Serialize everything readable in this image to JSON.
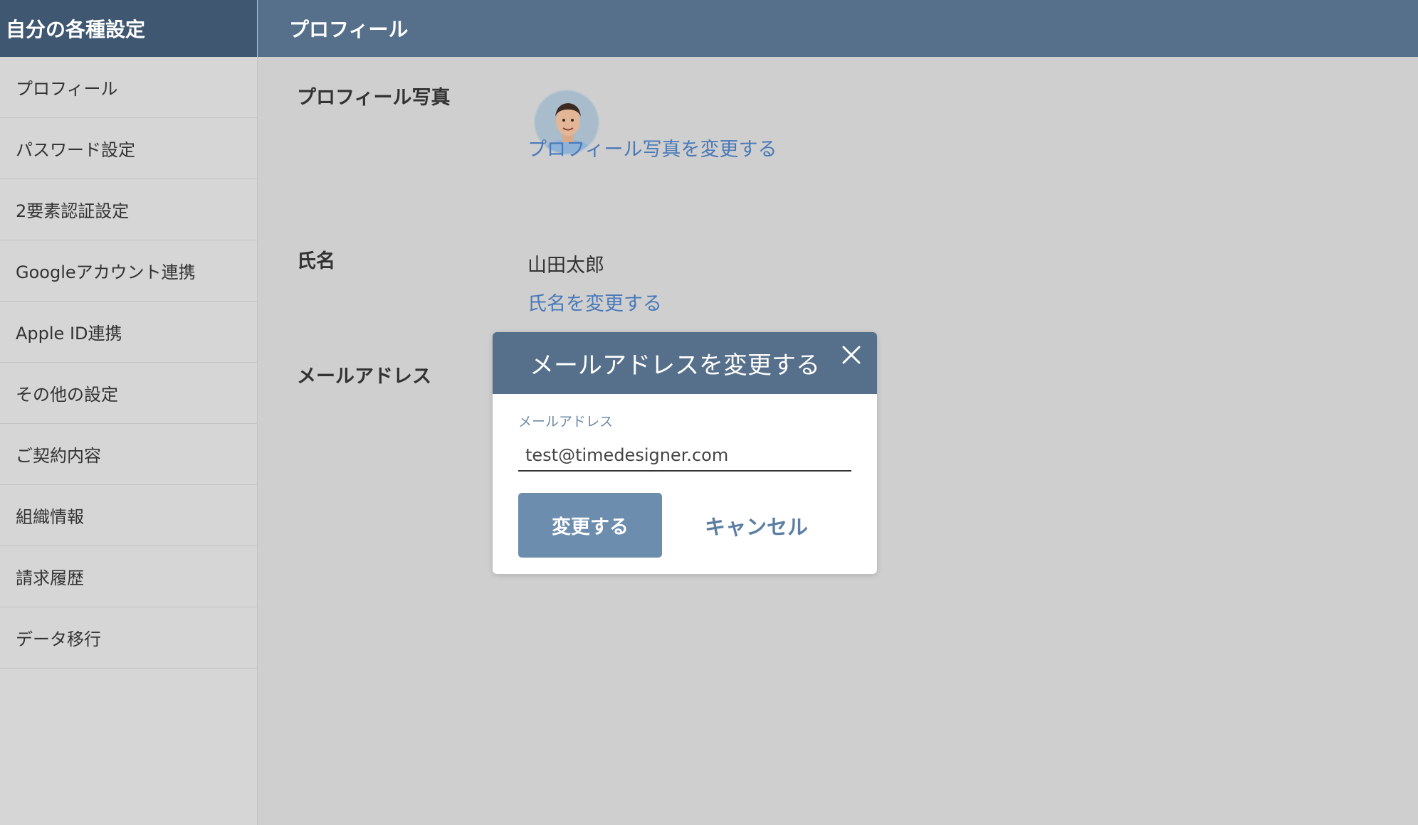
{
  "sidebar": {
    "title": "自分の各種設定",
    "items": [
      {
        "label": "プロフィール"
      },
      {
        "label": "パスワード設定"
      },
      {
        "label": "2要素認証設定"
      },
      {
        "label": "Googleアカウント連携"
      },
      {
        "label": "Apple ID連携"
      },
      {
        "label": "その他の設定"
      },
      {
        "label": "ご契約内容"
      },
      {
        "label": "組織情報"
      },
      {
        "label": "請求履歴"
      },
      {
        "label": "データ移行"
      }
    ]
  },
  "header": {
    "title": "プロフィール"
  },
  "profile": {
    "photo_label": "プロフィール写真",
    "photo_change_link": "プロフィール写真を変更する",
    "name_label": "氏名",
    "name_value": "山田太郎",
    "name_change_link": "氏名を変更する",
    "email_label": "メールアドレス"
  },
  "modal": {
    "title": "メールアドレスを変更する",
    "field_label": "メールアドレス",
    "field_value": "test@timedesigner.com",
    "submit_label": "変更する",
    "cancel_label": "キャンセル"
  },
  "colors": {
    "sidebar_header": "#3f5771",
    "topbar": "#566f8a",
    "link": "#4a79b8",
    "primary_button": "#6d8dae"
  }
}
